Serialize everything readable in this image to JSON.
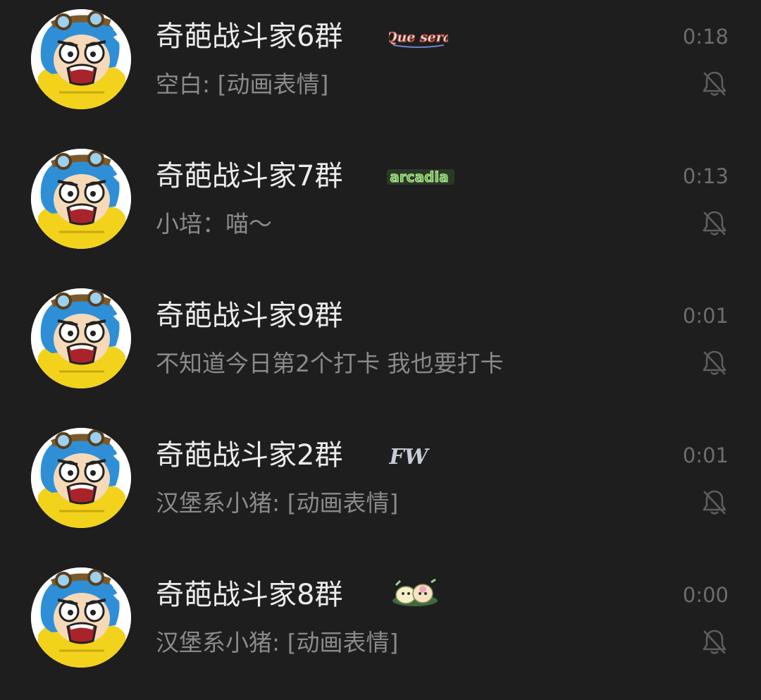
{
  "chats": [
    {
      "name": "奇葩战斗家6群",
      "badge_text": "Que sera",
      "preview": "空白: [动画表情]",
      "time": "0:18",
      "muted": true
    },
    {
      "name": "奇葩战斗家7群",
      "badge_text": "arcadia",
      "preview": "小培：喵～",
      "time": "0:13",
      "muted": true
    },
    {
      "name": "奇葩战斗家9群",
      "badge_text": "",
      "preview": "不知道今日第2个打卡  我也要打卡",
      "time": "0:01",
      "muted": true
    },
    {
      "name": "奇葩战斗家2群",
      "badge_text": "FW",
      "preview": "汉堡系小猪: [动画表情]",
      "time": "0:01",
      "muted": true
    },
    {
      "name": "奇葩战斗家8群",
      "badge_text": "",
      "preview": "汉堡系小猪: [动画表情]",
      "time": "0:00",
      "muted": true
    }
  ],
  "colors": {
    "background": "#1e1e1e",
    "name_text": "#ececec",
    "preview_text": "#8a8a8a",
    "time_text": "#6d6d6d",
    "avatar_yellow": "#f2d21b",
    "avatar_blue": "#2f8fd6",
    "badge_green": "#5fbf3a"
  },
  "icons": {
    "avatar": "cartoon-face-avatar",
    "mute": "bell-slash-icon",
    "badge_8": "dumplings-sticker"
  }
}
